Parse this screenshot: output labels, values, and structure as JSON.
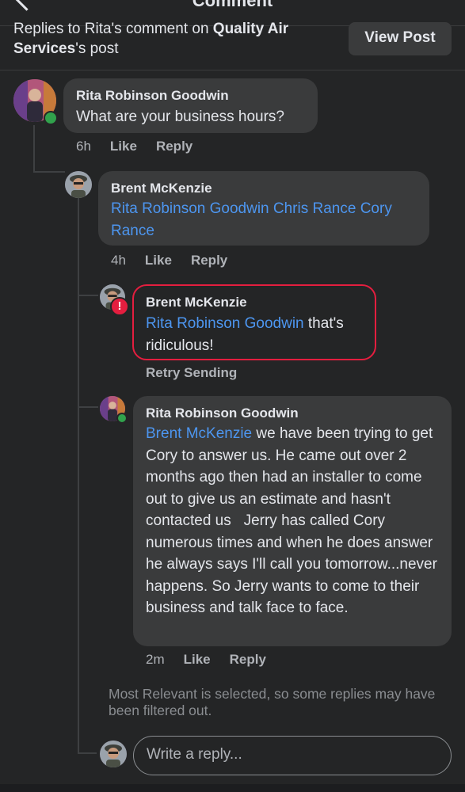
{
  "header": {
    "title": "Comment",
    "context_prefix": "Replies to Rita's comment on ",
    "context_page": "Quality Air Services",
    "context_suffix": "'s post",
    "view_post_label": "View Post"
  },
  "comments": [
    {
      "author": "Rita Robinson Goodwin",
      "text": "What are your business hours?",
      "time": "6h",
      "like": "Like",
      "reply": "Reply"
    },
    {
      "author": "Brent McKenzie",
      "mention": "Rita Robinson Goodwin Chris Rance Cory Rance",
      "time": "4h",
      "like": "Like",
      "reply": "Reply"
    },
    {
      "author": "Brent McKenzie",
      "mention": "Rita Robinson Goodwin",
      "text_after_mention": "that's ridiculous!",
      "status": "Retry Sending"
    },
    {
      "author": "Rita Robinson Goodwin",
      "mention": "Brent McKenzie",
      "text_after_mention": "we have been trying to get Cory to answer us. He came out over 2 months ago then had an installer to come out to give us an estimate and hasn't contacted us   Jerry has called Cory numerous times and when he does answer he always says I'll call you tomorrow...never happens. So Jerry wants to come to their business and talk face to face.",
      "time": "2m",
      "like": "Like",
      "reply": "Reply"
    }
  ],
  "filter_note": "Most Relevant is selected, so some replies may have been filtered out.",
  "reply_input": {
    "placeholder": "Write a reply..."
  },
  "colors": {
    "background": "#242526",
    "bubble": "#3a3b3c",
    "mention": "#4d96f0",
    "error": "#e41e3f",
    "online": "#31a24c"
  }
}
